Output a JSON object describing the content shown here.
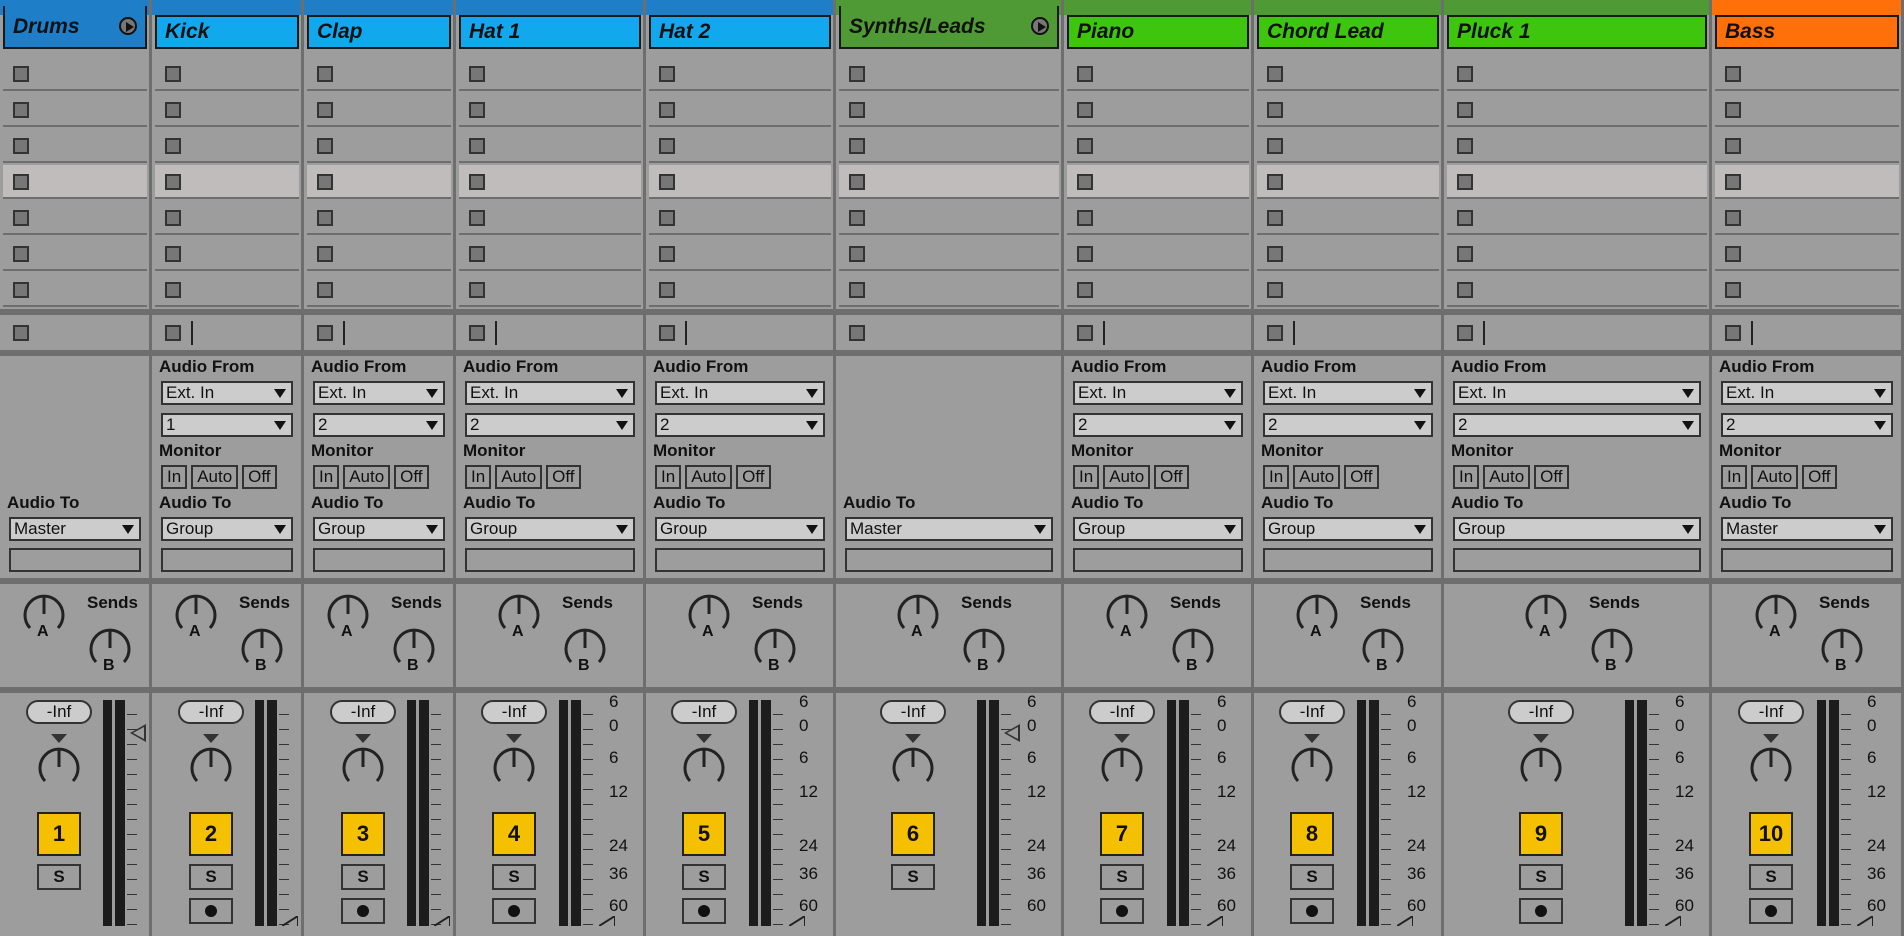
{
  "tracks": [
    {
      "name": "Drums",
      "type": "group",
      "number": "1",
      "color": "#1e7fc8",
      "band_color": "#1e7fc8",
      "audio_to": "Master",
      "volume": "-Inf",
      "solo": "S",
      "send_label": "Sends",
      "send_a": "A",
      "send_b": "B"
    },
    {
      "name": "Kick",
      "type": "audio",
      "number": "2",
      "color": "#12a8ee",
      "band_color": "#1e7fc8",
      "audio_from_label": "Audio From",
      "audio_from": "Ext. In",
      "input_channel": "1",
      "monitor_label": "Monitor",
      "monitor": [
        "In",
        "Auto",
        "Off"
      ],
      "audio_to_label": "Audio To",
      "audio_to": "Group",
      "volume": "-Inf",
      "solo": "S",
      "send_label": "Sends",
      "send_a": "A",
      "send_b": "B"
    },
    {
      "name": "Clap",
      "type": "audio",
      "number": "3",
      "color": "#12a8ee",
      "band_color": "#1e7fc8",
      "audio_from_label": "Audio From",
      "audio_from": "Ext. In",
      "input_channel": "2",
      "monitor_label": "Monitor",
      "monitor": [
        "In",
        "Auto",
        "Off"
      ],
      "audio_to_label": "Audio To",
      "audio_to": "Group",
      "volume": "-Inf",
      "solo": "S",
      "send_label": "Sends",
      "send_a": "A",
      "send_b": "B"
    },
    {
      "name": "Hat 1",
      "type": "audio",
      "number": "4",
      "color": "#12a8ee",
      "band_color": "#1e7fc8",
      "audio_from_label": "Audio From",
      "audio_from": "Ext. In",
      "input_channel": "2",
      "monitor_label": "Monitor",
      "monitor": [
        "In",
        "Auto",
        "Off"
      ],
      "audio_to_label": "Audio To",
      "audio_to": "Group",
      "volume": "-Inf",
      "solo": "S",
      "send_label": "Sends",
      "send_a": "A",
      "send_b": "B"
    },
    {
      "name": "Hat 2",
      "type": "audio",
      "number": "5",
      "color": "#12a8ee",
      "band_color": "#1e7fc8",
      "audio_from_label": "Audio From",
      "audio_from": "Ext. In",
      "input_channel": "2",
      "monitor_label": "Monitor",
      "monitor": [
        "In",
        "Auto",
        "Off"
      ],
      "audio_to_label": "Audio To",
      "audio_to": "Group",
      "volume": "-Inf",
      "solo": "S",
      "send_label": "Sends",
      "send_a": "A",
      "send_b": "B"
    },
    {
      "name": "Synths/Leads",
      "type": "group",
      "number": "6",
      "color": "#4f9a35",
      "band_color": "#4f9a35",
      "audio_to": "Master",
      "volume": "-Inf",
      "solo": "S",
      "send_label": "Sends",
      "send_a": "A",
      "send_b": "B"
    },
    {
      "name": "Piano",
      "type": "audio",
      "number": "7",
      "color": "#3ec50e",
      "band_color": "#4f9a35",
      "audio_from_label": "Audio From",
      "audio_from": "Ext. In",
      "input_channel": "2",
      "monitor_label": "Monitor",
      "monitor": [
        "In",
        "Auto",
        "Off"
      ],
      "audio_to_label": "Audio To",
      "audio_to": "Group",
      "volume": "-Inf",
      "solo": "S",
      "send_label": "Sends",
      "send_a": "A",
      "send_b": "B"
    },
    {
      "name": "Chord Lead",
      "type": "audio",
      "number": "8",
      "color": "#3ec50e",
      "band_color": "#4f9a35",
      "audio_from_label": "Audio From",
      "audio_from": "Ext. In",
      "input_channel": "2",
      "monitor_label": "Monitor",
      "monitor": [
        "In",
        "Auto",
        "Off"
      ],
      "audio_to_label": "Audio To",
      "audio_to": "Group",
      "volume": "-Inf",
      "solo": "S",
      "send_label": "Sends",
      "send_a": "A",
      "send_b": "B"
    },
    {
      "name": "Pluck 1",
      "type": "audio",
      "number": "9",
      "color": "#3ec50e",
      "band_color": "#4f9a35",
      "audio_from_label": "Audio From",
      "audio_from": "Ext. In",
      "input_channel": "2",
      "monitor_label": "Monitor",
      "monitor": [
        "In",
        "Auto",
        "Off"
      ],
      "audio_to_label": "Audio To",
      "audio_to": "Group",
      "volume": "-Inf",
      "solo": "S",
      "send_label": "Sends",
      "send_a": "A",
      "send_b": "B"
    },
    {
      "name": "Bass",
      "type": "audio",
      "number": "10",
      "color": "#ff6f0a",
      "band_color": "#ff6f0a",
      "audio_from_label": "Audio From",
      "audio_from": "Ext. In",
      "input_channel": "2",
      "monitor_label": "Monitor",
      "monitor": [
        "In",
        "Auto",
        "Off"
      ],
      "audio_to_label": "Audio To",
      "audio_to": "Master",
      "volume": "-Inf",
      "solo": "S",
      "send_label": "Sends",
      "send_a": "A",
      "send_b": "B"
    }
  ],
  "audio_to_label": "Audio To",
  "meter_scale": [
    "6",
    "0",
    "6",
    "12",
    "24",
    "36",
    "60"
  ],
  "selected_scene": 4
}
